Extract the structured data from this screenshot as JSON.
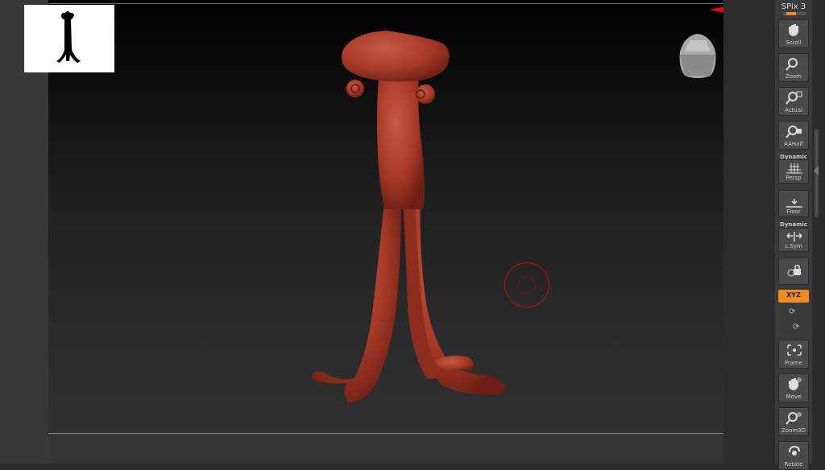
{
  "toolbar": {
    "spix_label": "SPix 3",
    "buttons": {
      "scroll": "Scroll",
      "zoom": "Zoom",
      "actual": "Actual",
      "aahalf": "AAHalf",
      "persp": "Persp",
      "floor": "Floor",
      "lsym": "L.Sym",
      "frame": "Frame",
      "move": "Move",
      "zoom3d": "Zoom3D",
      "rotate": "Rotate"
    },
    "dynamic_persp": "Dynamic",
    "dynamic_lsym": "Dynamic",
    "xyz_label": "XYZ",
    "accent_color": "#f08a24"
  },
  "viewport": {
    "model_color": "#a63a28",
    "gizmo_colors": {
      "x": "#ff0000",
      "y": "#00cc00",
      "z": "#0000ff"
    },
    "brush_color": "#bb1111"
  }
}
